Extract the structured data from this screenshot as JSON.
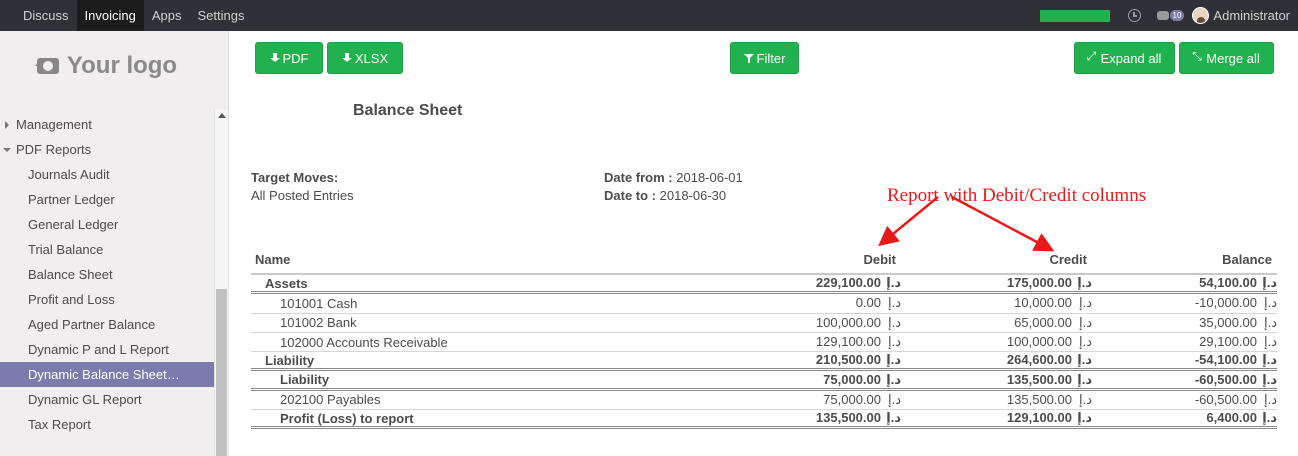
{
  "navbar": {
    "apps": [
      "Discuss",
      "Invoicing",
      "Apps",
      "Settings"
    ],
    "active_app": "Invoicing",
    "progress_fraction": 1.0,
    "chat_badge": "10",
    "user_name": "Administrator"
  },
  "sidebar": {
    "logo_text": "Your logo",
    "items": [
      {
        "label": "Management",
        "level": "top",
        "expanded": false
      },
      {
        "label": "PDF Reports",
        "level": "top",
        "expanded": true
      },
      {
        "label": "Journals Audit",
        "level": "sub"
      },
      {
        "label": "Partner Ledger",
        "level": "sub"
      },
      {
        "label": "General Ledger",
        "level": "sub"
      },
      {
        "label": "Trial Balance",
        "level": "sub"
      },
      {
        "label": "Balance Sheet",
        "level": "sub"
      },
      {
        "label": "Profit and Loss",
        "level": "sub"
      },
      {
        "label": "Aged Partner Balance",
        "level": "sub"
      },
      {
        "label": "Dynamic P and L Report",
        "level": "sub"
      },
      {
        "label": "Dynamic Balance Sheet…",
        "level": "sub",
        "active": true
      },
      {
        "label": "Dynamic GL Report",
        "level": "sub"
      },
      {
        "label": "Tax Report",
        "level": "sub"
      }
    ]
  },
  "toolbar": {
    "pdf_label": "PDF",
    "xlsx_label": "XLSX",
    "filter_label": "Filter",
    "expand_label": "Expand all",
    "merge_label": "Merge all"
  },
  "report": {
    "title": "Balance Sheet",
    "target_moves_label": "Target Moves:",
    "target_moves_value": "All Posted Entries",
    "date_from_label": "Date from :",
    "date_from_value": "2018-06-01",
    "date_to_label": "Date to :",
    "date_to_value": "2018-06-30"
  },
  "annotation": "Report with Debit/Credit columns",
  "table": {
    "headers": [
      "Name",
      "Debit",
      "Credit",
      "Balance"
    ],
    "currency": "د.إ",
    "rows": [
      {
        "name": "Assets",
        "indent": 1,
        "bold": true,
        "double": true,
        "debit": "229,100.00",
        "credit": "175,000.00",
        "balance": "54,100.00"
      },
      {
        "name": "101001 Cash",
        "indent": 3,
        "bold": false,
        "double": false,
        "debit": "0.00",
        "credit": "10,000.00",
        "balance": "-10,000.00"
      },
      {
        "name": "101002 Bank",
        "indent": 3,
        "bold": false,
        "double": false,
        "debit": "100,000.00",
        "credit": "65,000.00",
        "balance": "35,000.00"
      },
      {
        "name": "102000 Accounts Receivable",
        "indent": 3,
        "bold": false,
        "double": false,
        "debit": "129,100.00",
        "credit": "100,000.00",
        "balance": "29,100.00"
      },
      {
        "name": "Liability",
        "indent": 1,
        "bold": true,
        "double": true,
        "debit": "210,500.00",
        "credit": "264,600.00",
        "balance": "-54,100.00"
      },
      {
        "name": "Liability",
        "indent": 2,
        "bold": true,
        "double": true,
        "debit": "75,000.00",
        "credit": "135,500.00",
        "balance": "-60,500.00"
      },
      {
        "name": "202100 Payables",
        "indent": 3,
        "bold": false,
        "double": false,
        "debit": "75,000.00",
        "credit": "135,500.00",
        "balance": "-60,500.00"
      },
      {
        "name": "Profit (Loss) to report",
        "indent": 2,
        "bold": true,
        "double": true,
        "debit": "135,500.00",
        "credit": "129,100.00",
        "balance": "6,400.00"
      }
    ]
  }
}
